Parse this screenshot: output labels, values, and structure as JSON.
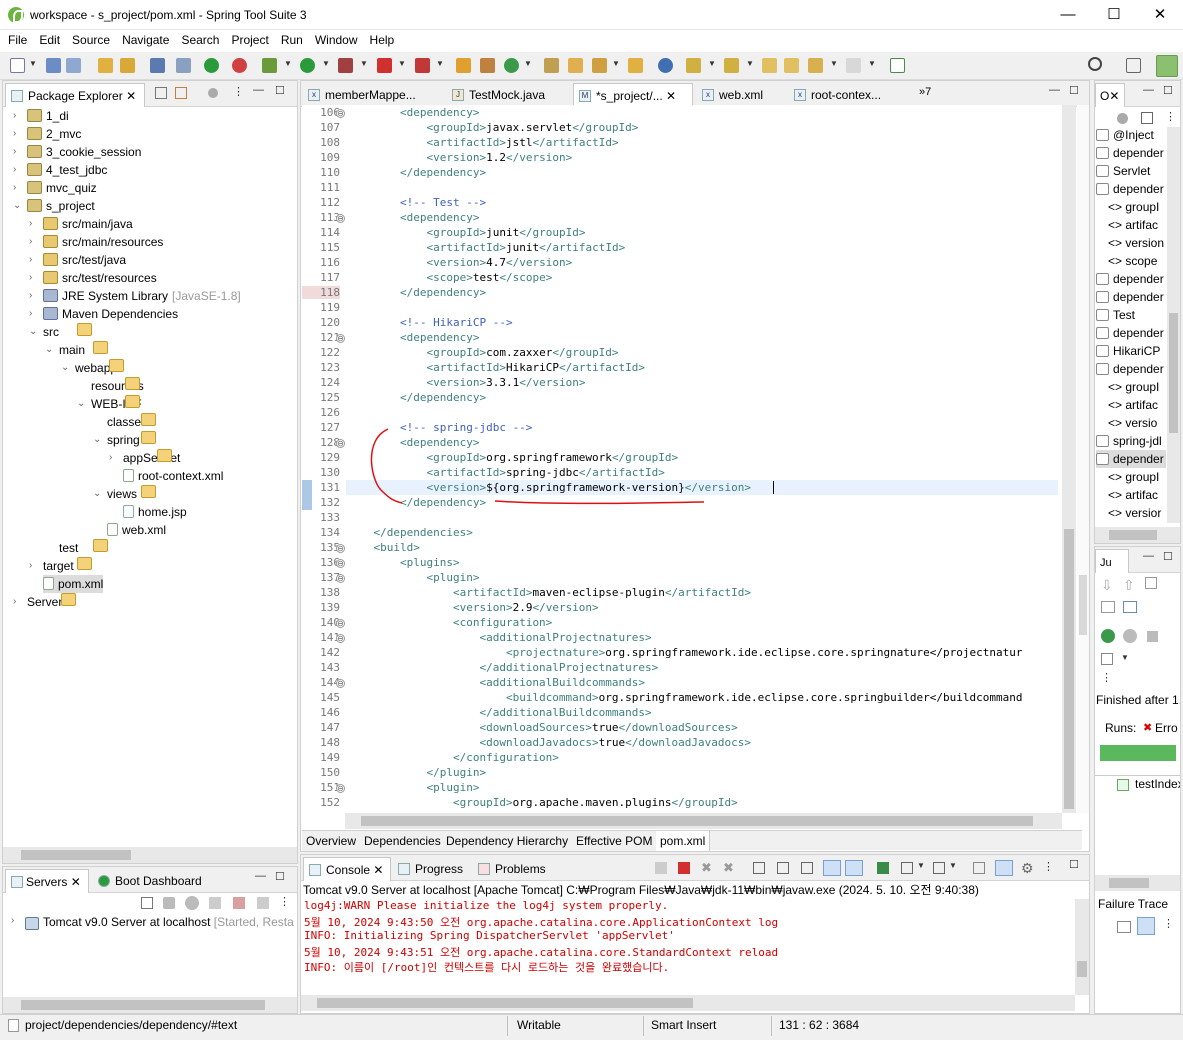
{
  "window": {
    "title": "workspace - s_project/pom.xml - Spring Tool Suite 3",
    "minimize": "—",
    "maximize": "☐",
    "close": "✕"
  },
  "menu": [
    "File",
    "Edit",
    "Source",
    "Navigate",
    "Search",
    "Project",
    "Run",
    "Window",
    "Help"
  ],
  "package_explorer": {
    "tab": "Package Explorer",
    "items": [
      {
        "label": "1_di",
        "deco": "",
        "icon": "proj",
        "indent": 0,
        "tw": "›"
      },
      {
        "label": "2_mvc",
        "deco": "",
        "icon": "proj",
        "indent": 0,
        "tw": "›"
      },
      {
        "label": "3_cookie_session",
        "deco": "",
        "icon": "proj",
        "indent": 0,
        "tw": "›"
      },
      {
        "label": "4_test_jdbc",
        "deco": "",
        "icon": "proj",
        "indent": 0,
        "tw": "›"
      },
      {
        "label": "mvc_quiz",
        "deco": "",
        "icon": "proj",
        "indent": 0,
        "tw": "›"
      },
      {
        "label": "s_project",
        "deco": "",
        "icon": "proj",
        "indent": 0,
        "tw": "⌄"
      },
      {
        "label": "src/main/java",
        "deco": "",
        "icon": "src",
        "indent": 1,
        "tw": "›"
      },
      {
        "label": "src/main/resources",
        "deco": "",
        "icon": "src",
        "indent": 1,
        "tw": "›"
      },
      {
        "label": "src/test/java",
        "deco": "",
        "icon": "src",
        "indent": 1,
        "tw": "›"
      },
      {
        "label": "src/test/resources",
        "deco": "",
        "icon": "src",
        "indent": 1,
        "tw": "›"
      },
      {
        "label": "JRE System Library",
        "deco": "[JavaSE-1.8]",
        "icon": "lib",
        "indent": 1,
        "tw": "›"
      },
      {
        "label": "Maven Dependencies",
        "deco": "",
        "icon": "lib",
        "indent": 1,
        "tw": "›"
      },
      {
        "label": "src",
        "deco": "",
        "icon": "fold",
        "indent": 1,
        "tw": "⌄"
      },
      {
        "label": "main",
        "deco": "",
        "icon": "fold",
        "indent": 2,
        "tw": "⌄"
      },
      {
        "label": "webapp",
        "deco": "",
        "icon": "fold",
        "indent": 3,
        "tw": "⌄"
      },
      {
        "label": "resources",
        "deco": "",
        "icon": "fold",
        "indent": 4,
        "tw": ""
      },
      {
        "label": "WEB-INF",
        "deco": "",
        "icon": "fold",
        "indent": 4,
        "tw": "⌄"
      },
      {
        "label": "classes",
        "deco": "",
        "icon": "fold",
        "indent": 5,
        "tw": ""
      },
      {
        "label": "spring",
        "deco": "",
        "icon": "fold",
        "indent": 5,
        "tw": "⌄"
      },
      {
        "label": "appServlet",
        "deco": "",
        "icon": "fold",
        "indent": 6,
        "tw": "›"
      },
      {
        "label": "root-context.xml",
        "deco": "",
        "icon": "xml",
        "indent": 6,
        "tw": ""
      },
      {
        "label": "views",
        "deco": "",
        "icon": "fold",
        "indent": 5,
        "tw": "⌄"
      },
      {
        "label": "home.jsp",
        "deco": "",
        "icon": "file",
        "indent": 6,
        "tw": ""
      },
      {
        "label": "web.xml",
        "deco": "",
        "icon": "xml",
        "indent": 5,
        "tw": ""
      },
      {
        "label": "test",
        "deco": "",
        "icon": "fold",
        "indent": 2,
        "tw": ""
      },
      {
        "label": "target",
        "deco": "",
        "icon": "fold",
        "indent": 1,
        "tw": "›"
      },
      {
        "label": "pom.xml",
        "deco": "",
        "icon": "xml",
        "indent": 1,
        "tw": ""
      },
      {
        "label": "Servers",
        "deco": "",
        "icon": "fold",
        "indent": 0,
        "tw": "›"
      }
    ]
  },
  "servers_panel": {
    "tab1": "Servers",
    "tab2": "Boot Dashboard",
    "server": "Tomcat v9.0 Server at localhost",
    "status": "[Started, Resta"
  },
  "editor_tabs": [
    "memberMappe...",
    "TestMock.java",
    "*s_project/...",
    "web.xml",
    "root-contex...",
    "»7"
  ],
  "code": [
    {
      "n": "106",
      "f": "⊖",
      "t": "        <dependency>"
    },
    {
      "n": "107",
      "f": "",
      "t": "            <groupId>javax.servlet</groupId>"
    },
    {
      "n": "108",
      "f": "",
      "t": "            <artifactId>jstl</artifactId>"
    },
    {
      "n": "109",
      "f": "",
      "t": "            <version>1.2</version>"
    },
    {
      "n": "110",
      "f": "",
      "t": "        </dependency>"
    },
    {
      "n": "111",
      "f": "",
      "t": ""
    },
    {
      "n": "112",
      "f": "",
      "t": "        <!-- Test -->"
    },
    {
      "n": "113",
      "f": "⊖",
      "t": "        <dependency>"
    },
    {
      "n": "114",
      "f": "",
      "t": "            <groupId>junit</groupId>"
    },
    {
      "n": "115",
      "f": "",
      "t": "            <artifactId>junit</artifactId>"
    },
    {
      "n": "116",
      "f": "",
      "t": "            <version>4.7</version>"
    },
    {
      "n": "117",
      "f": "",
      "t": "            <scope>test</scope>"
    },
    {
      "n": "118",
      "f": "",
      "t": "        </dependency>"
    },
    {
      "n": "119",
      "f": "",
      "t": ""
    },
    {
      "n": "120",
      "f": "",
      "t": "        <!-- HikariCP -->"
    },
    {
      "n": "121",
      "f": "⊖",
      "t": "        <dependency>"
    },
    {
      "n": "122",
      "f": "",
      "t": "            <groupId>com.zaxxer</groupId>"
    },
    {
      "n": "123",
      "f": "",
      "t": "            <artifactId>HikariCP</artifactId>"
    },
    {
      "n": "124",
      "f": "",
      "t": "            <version>3.3.1</version>"
    },
    {
      "n": "125",
      "f": "",
      "t": "        </dependency>"
    },
    {
      "n": "126",
      "f": "",
      "t": ""
    },
    {
      "n": "127",
      "f": "",
      "t": "        <!-- spring-jdbc -->"
    },
    {
      "n": "128",
      "f": "⊖",
      "t": "        <dependency>"
    },
    {
      "n": "129",
      "f": "",
      "t": "            <groupId>org.springframework</groupId>"
    },
    {
      "n": "130",
      "f": "",
      "t": "            <artifactId>spring-jdbc</artifactId>"
    },
    {
      "n": "131",
      "f": "",
      "t": "            <version>${org.springframework-version}</version>"
    },
    {
      "n": "132",
      "f": "",
      "t": "        </dependency>"
    },
    {
      "n": "133",
      "f": "",
      "t": ""
    },
    {
      "n": "134",
      "f": "",
      "t": "    </dependencies>"
    },
    {
      "n": "135",
      "f": "⊖",
      "t": "    <build>"
    },
    {
      "n": "136",
      "f": "⊖",
      "t": "        <plugins>"
    },
    {
      "n": "137",
      "f": "⊖",
      "t": "            <plugin>"
    },
    {
      "n": "138",
      "f": "",
      "t": "                <artifactId>maven-eclipse-plugin</artifactId>"
    },
    {
      "n": "139",
      "f": "",
      "t": "                <version>2.9</version>"
    },
    {
      "n": "140",
      "f": "⊖",
      "t": "                <configuration>"
    },
    {
      "n": "141",
      "f": "⊖",
      "t": "                    <additionalProjectnatures>"
    },
    {
      "n": "142",
      "f": "",
      "t": "                        <projectnature>org.springframework.ide.eclipse.core.springnature</projectnatur"
    },
    {
      "n": "143",
      "f": "",
      "t": "                    </additionalProjectnatures>"
    },
    {
      "n": "144",
      "f": "⊖",
      "t": "                    <additionalBuildcommands>"
    },
    {
      "n": "145",
      "f": "",
      "t": "                        <buildcommand>org.springframework.ide.eclipse.core.springbuilder</buildcommand"
    },
    {
      "n": "146",
      "f": "",
      "t": "                    </additionalBuildcommands>"
    },
    {
      "n": "147",
      "f": "",
      "t": "                    <downloadSources>true</downloadSources>"
    },
    {
      "n": "148",
      "f": "",
      "t": "                    <downloadJavadocs>true</downloadJavadocs>"
    },
    {
      "n": "149",
      "f": "",
      "t": "                </configuration>"
    },
    {
      "n": "150",
      "f": "",
      "t": "            </plugin>"
    },
    {
      "n": "151",
      "f": "⊖",
      "t": "            <plugin>"
    },
    {
      "n": "152",
      "f": "",
      "t": "                <groupId>org.apache.maven.plugins</groupId>"
    }
  ],
  "pom_tabs": [
    "Overview",
    "Dependencies",
    "Dependency Hierarchy",
    "Effective POM",
    "pom.xml"
  ],
  "console": {
    "tab1": "Console",
    "tab2": "Progress",
    "tab3": "Problems",
    "header": "Tomcat v9.0 Server at localhost [Apache Tomcat] C:₩Program Files₩Java₩jdk-11₩bin₩javaw.exe  (2024. 5. 10. 오전 9:40:38)",
    "lines": [
      "log4j:WARN Please initialize the log4j system properly.",
      "5월 10, 2024 9:43:50 오전 org.apache.catalina.core.ApplicationContext log",
      "INFO: Initializing Spring DispatcherServlet 'appServlet'",
      "5월 10, 2024 9:43:51 오전 org.apache.catalina.core.StandardContext reload",
      "INFO: 이름이 [/root]인 컨텍스트를 다시 로드하는 것을 완료했습니다."
    ]
  },
  "outline": {
    "tab": "O",
    "items": [
      {
        "t": "@Inject",
        "ind": 0
      },
      {
        "t": "depender",
        "ind": 0
      },
      {
        "t": "Servlet",
        "ind": 0
      },
      {
        "t": "depender",
        "ind": 0
      },
      {
        "t": "<> groupI",
        "ind": 1
      },
      {
        "t": "<> artifac",
        "ind": 1
      },
      {
        "t": "<> version",
        "ind": 1
      },
      {
        "t": "<> scope",
        "ind": 1
      },
      {
        "t": "depender",
        "ind": 0
      },
      {
        "t": "depender",
        "ind": 0
      },
      {
        "t": "Test",
        "ind": 0
      },
      {
        "t": "depender",
        "ind": 0
      },
      {
        "t": "HikariCP",
        "ind": 0
      },
      {
        "t": "depender",
        "ind": 0
      },
      {
        "t": "<> groupI",
        "ind": 1
      },
      {
        "t": "<> artifac",
        "ind": 1
      },
      {
        "t": "<> versio",
        "ind": 1
      },
      {
        "t": "spring-jdl",
        "ind": 0
      },
      {
        "t": "depender",
        "ind": 0
      },
      {
        "t": "<> groupI",
        "ind": 1
      },
      {
        "t": "<> artifac",
        "ind": 1
      },
      {
        "t": "<> versior",
        "ind": 1
      }
    ]
  },
  "junit": {
    "finished": "Finished after 1.",
    "runs": "Runs:",
    "errors": "Erro",
    "testitem": "testIndex",
    "failure": "Failure Trace"
  },
  "status": {
    "path": "project/dependencies/dependency/#text",
    "writable": "Writable",
    "insert": "Smart Insert",
    "pos": "131 : 62 : 3684"
  }
}
